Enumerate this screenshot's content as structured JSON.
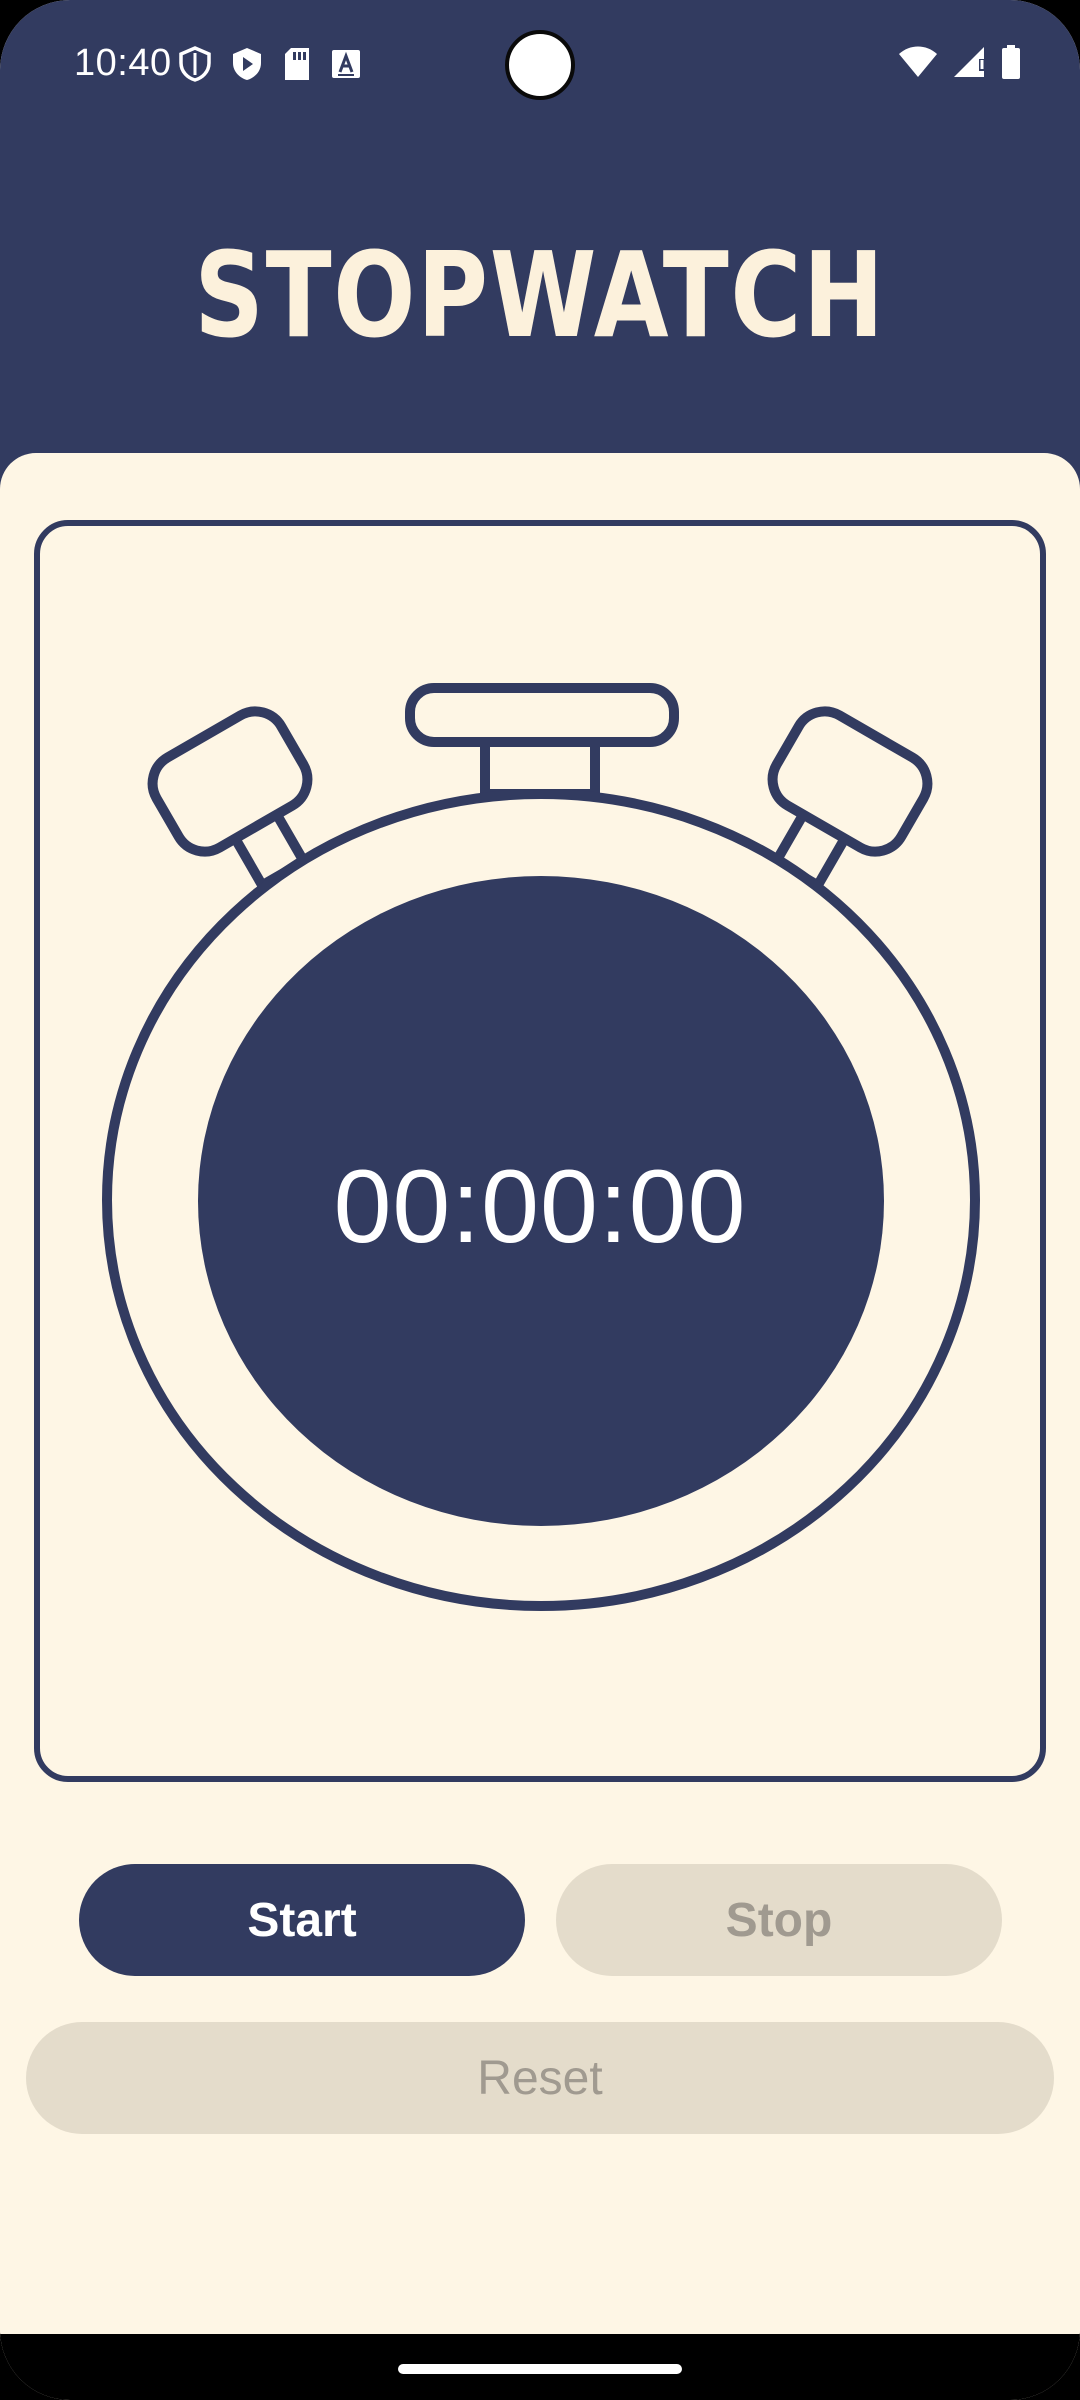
{
  "status_bar": {
    "time": "10:40",
    "left_icons": [
      "shield-outline-icon",
      "shield-play-icon",
      "sd-card-icon",
      "keyboard-a-icon"
    ],
    "right_icons": [
      "wifi-icon",
      "signal-icon",
      "battery-icon"
    ]
  },
  "header": {
    "title": "STOPWATCH"
  },
  "stopwatch": {
    "time": "00:00:00"
  },
  "buttons": {
    "start_label": "Start",
    "stop_label": "Stop",
    "reset_label": "Reset"
  },
  "colors": {
    "primary": "#323B60",
    "background": "#FEF6E5",
    "title": "#FCF1DC",
    "disabled_bg": "#E4DCCB",
    "disabled_text": "#A09A90"
  }
}
